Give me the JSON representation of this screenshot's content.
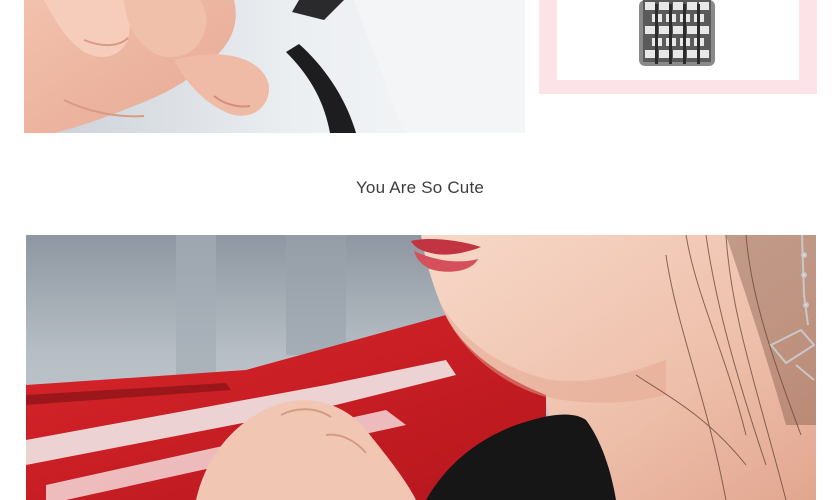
{
  "caption": {
    "text": "You Are So Cute"
  },
  "images": {
    "top_left": "hands-holding-bag-strap-photo",
    "top_right": "silver-bracelet-product-photo",
    "main": "woman-with-earring-and-red-car-photo"
  },
  "colors": {
    "frame_pink": "#fbe3e8",
    "caption_text": "#3d3d3d"
  }
}
